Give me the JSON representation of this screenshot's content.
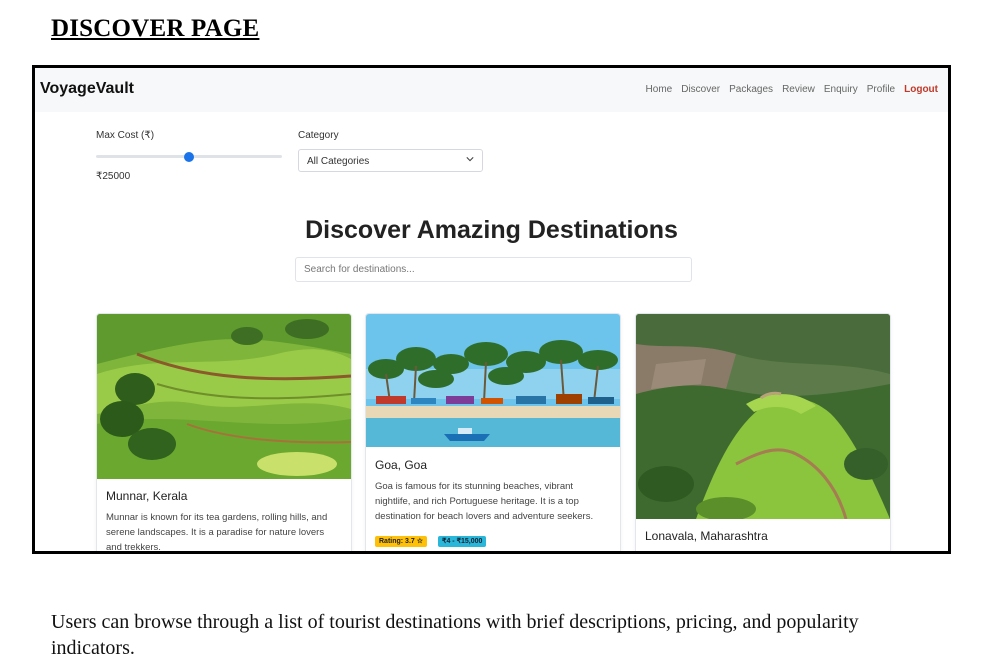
{
  "doc": {
    "heading": "DISCOVER PAGE",
    "caption": "Users can browse through a list of tourist destinations with brief descriptions, pricing, and popularity indicators."
  },
  "navbar": {
    "brand": "VoyageVault",
    "links": [
      "Home",
      "Discover",
      "Packages",
      "Review",
      "Enquiry",
      "Profile"
    ],
    "logout": "Logout"
  },
  "filters": {
    "max_cost_label": "Max Cost (₹)",
    "max_cost_value": "₹25000",
    "slider_fraction": 0.5,
    "category_label": "Category",
    "category_selected": "All Categories"
  },
  "main": {
    "title": "Discover Amazing Destinations",
    "search_placeholder": "Search for destinations..."
  },
  "cards": [
    {
      "title": "Munnar, Kerala",
      "description": "Munnar is known for its tea gardens, rolling hills, and serene landscapes. It is a paradise for nature lovers and trekkers.",
      "image": "tea-gardens-hills"
    },
    {
      "title": "Goa, Goa",
      "description": "Goa is famous for its stunning beaches, vibrant nightlife, and rich Portuguese heritage. It is a top destination for beach lovers and adventure seekers.",
      "image": "beach-palm-trees",
      "rating": "Rating: 3.7 ☆",
      "price": "₹4 - ₹15,000"
    },
    {
      "title": "Lonavala, Maharashtra",
      "description": "",
      "image": "green-mountain-hilltop"
    }
  ],
  "colors": {
    "accent": "#1a73e8",
    "logout": "#c0392b",
    "rating_badge": "#ffc107",
    "price_badge": "#29b6d9"
  }
}
